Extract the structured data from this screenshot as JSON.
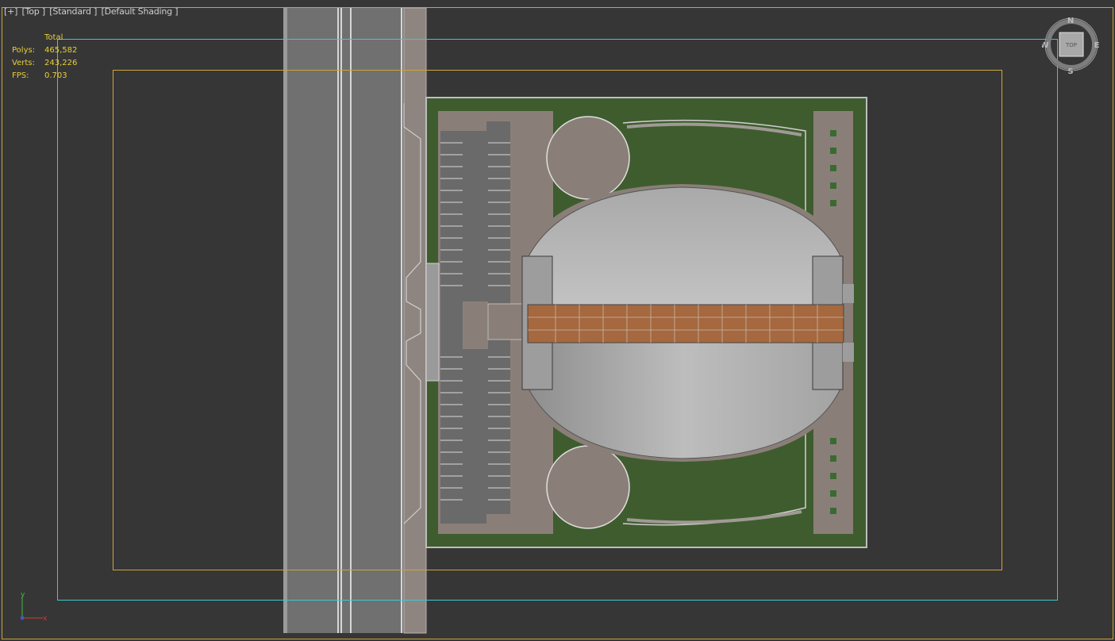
{
  "viewport_labels": [
    {
      "text": "[+]"
    },
    {
      "text": "[Top ]"
    },
    {
      "text": "[Standard ]"
    },
    {
      "text": "[Default Shading ]"
    }
  ],
  "stats": {
    "header": "Total",
    "polys_label": "Polys:",
    "polys_value": "465,582",
    "verts_label": "Verts:",
    "verts_value": "243,226",
    "fps_label": "FPS:",
    "fps_value": "0.703"
  },
  "viewcube": {
    "face_label": "TOP",
    "north": "N",
    "south": "S",
    "east": "E",
    "west": "W"
  },
  "axis_gizmo": {
    "x_label": "x",
    "y_label": "y"
  },
  "colors": {
    "background": "#363636",
    "viewport_border": "#c9a63a",
    "safe_frame": "#3fc6d0",
    "stats_text": "#e7cf3a",
    "grass": "#3f5c2f",
    "asphalt": "#6e6e6e",
    "pavement": "#8a7f78",
    "roof": "#b8b8b8",
    "skylight": "#a5683f"
  }
}
